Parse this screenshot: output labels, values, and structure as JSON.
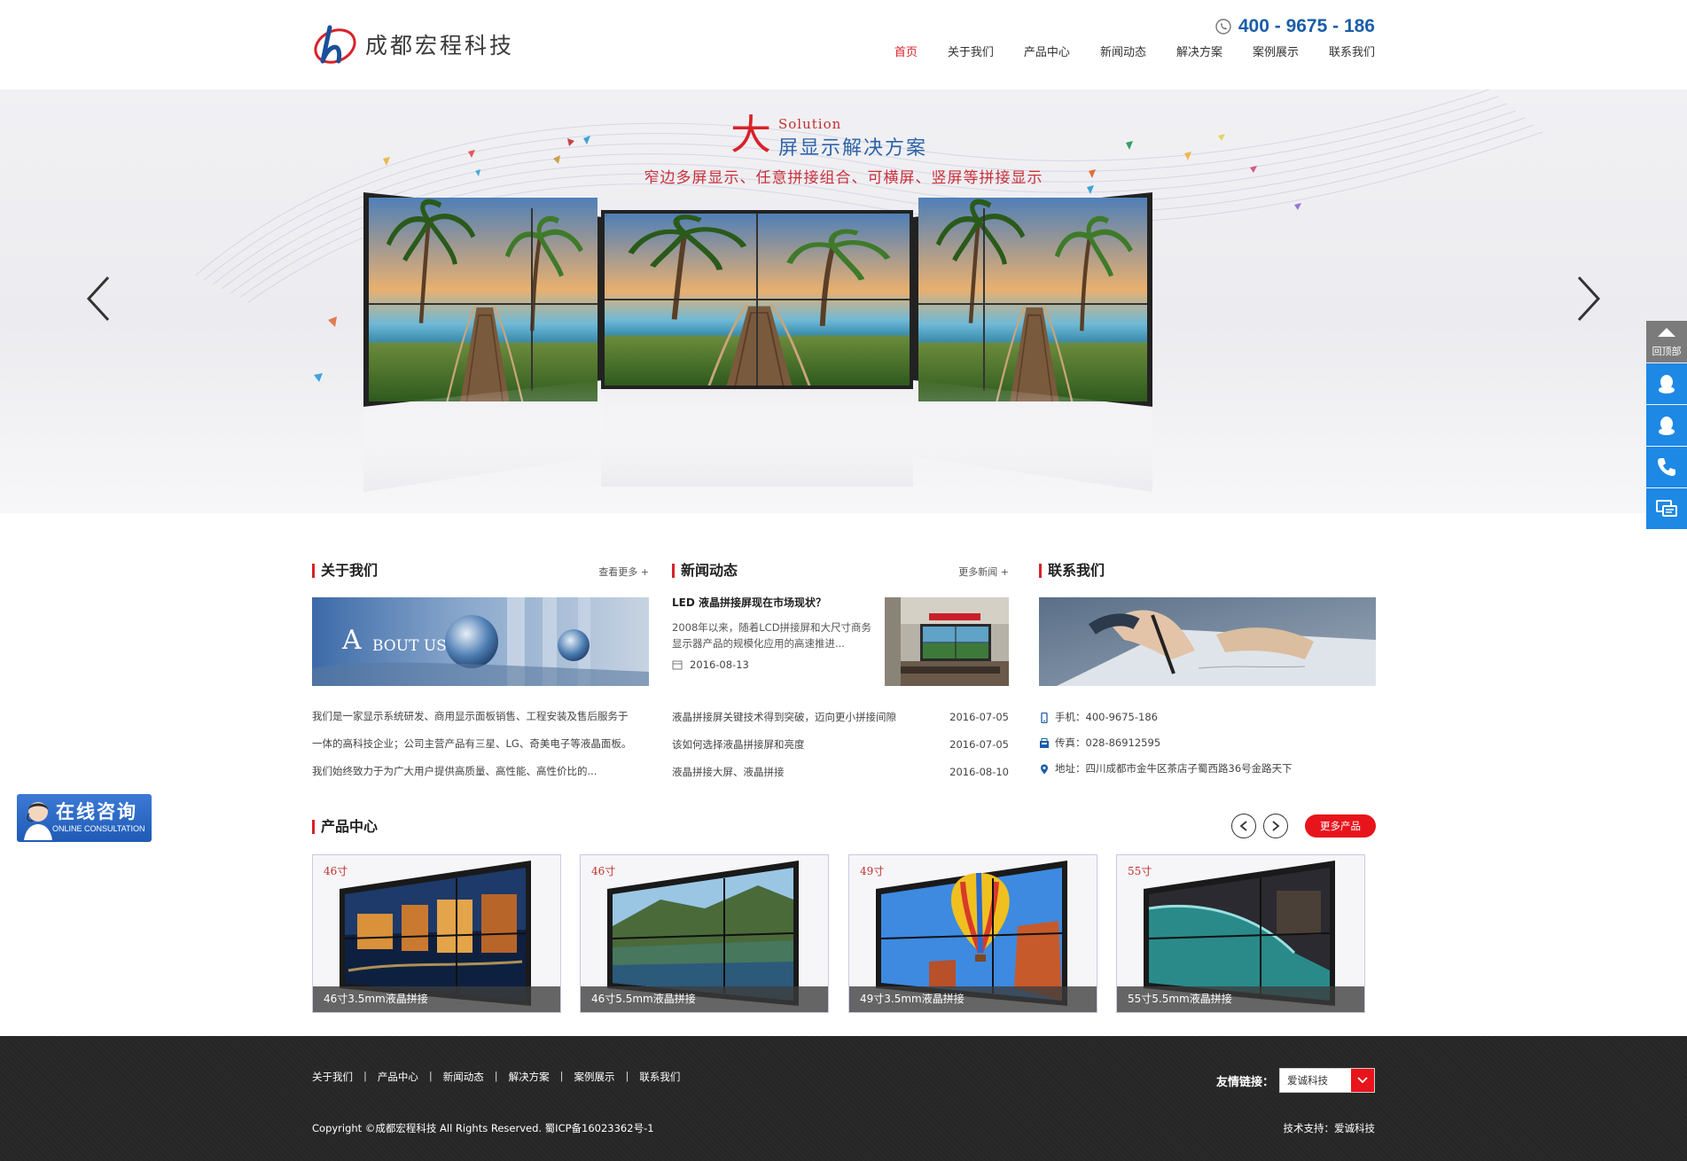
{
  "header": {
    "logo_text": "成都宏程科技",
    "hotline": "400 - 9675 - 186",
    "nav": [
      {
        "label": "首页",
        "active": true
      },
      {
        "label": "关于我们",
        "active": false
      },
      {
        "label": "产品中心",
        "active": false
      },
      {
        "label": "新闻动态",
        "active": false
      },
      {
        "label": "解决方案",
        "active": false
      },
      {
        "label": "案例展示",
        "active": false
      },
      {
        "label": "联系我们",
        "active": false
      }
    ]
  },
  "banner": {
    "title_big": "大",
    "title_en": "Solution",
    "title_cn": "屏显示解决方案",
    "subtitle": "窄边多屏显示、任意拼接组合、可横屏、竖屏等拼接显示"
  },
  "sidebar": {
    "back_to_top": "回顶部",
    "buttons": [
      "qq-icon",
      "qq-icon",
      "phone-icon",
      "chat-icon"
    ]
  },
  "consult": {
    "title": "在线咨询",
    "subtitle": "ONLINE CONSULTATION"
  },
  "about": {
    "title": "关于我们",
    "more": "查看更多 +",
    "image_text": "A BOUT US",
    "lines": [
      "我们是一家显示系统研发、商用显示面板销售、工程安装及售后服务于",
      "一体的高科技企业；公司主营产品有三星、LG、奇美电子等液晶面板。",
      "我们始终致力于为广大用户提供高质量、高性能、高性价比的..."
    ]
  },
  "news": {
    "title": "新闻动态",
    "more": "更多新闻 +",
    "feature": {
      "title": "LED 液晶拼接屏现在市场现状？",
      "desc": "2008年以来，随着LCD拼接屏和大尺寸商务显示器产品的规模化应用的高速推进...",
      "date": "2016-08-13"
    },
    "items": [
      {
        "title": "液晶拼接屏关键技术得到突破，迈向更小拼接间隙",
        "date": "2016-07-05"
      },
      {
        "title": "该如何选择液晶拼接屏和亮度",
        "date": "2016-07-05"
      },
      {
        "title": "液晶拼接大屏、液晶拼接",
        "date": "2016-08-10"
      }
    ]
  },
  "contact": {
    "title": "联系我们",
    "phone": "手机：400-9675-186",
    "fax": "传真：028-86912595",
    "address": "地址：四川成都市金牛区茶店子蜀西路36号金路天下"
  },
  "products": {
    "title": "产品中心",
    "more": "更多产品",
    "items": [
      {
        "tag": "46寸",
        "caption": "46寸3.5mm液晶拼接"
      },
      {
        "tag": "46寸",
        "caption": "46寸5.5mm液晶拼接"
      },
      {
        "tag": "49寸",
        "caption": "49寸3.5mm液晶拼接"
      },
      {
        "tag": "55寸",
        "caption": "55寸5.5mm液晶拼接"
      }
    ]
  },
  "footer": {
    "links": [
      "关于我们",
      "产品中心",
      "新闻动态",
      "解决方案",
      "案例展示",
      "联系我们"
    ],
    "separator": "|",
    "copyright": "Copyright ©成都宏程科技 All Rights Reserved. 蜀ICP备16023362号-1",
    "friend_label": "友情链接：",
    "friend_selected": "爱诚科技",
    "support": "技术支持：爱诚科技"
  },
  "colors": {
    "accent_red": "#d8222a",
    "brand_blue": "#1a5ea8",
    "side_blue": "#1e88e5",
    "footer_bg": "#262626"
  }
}
